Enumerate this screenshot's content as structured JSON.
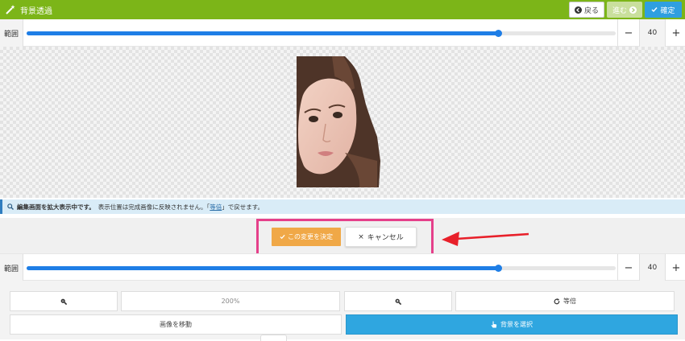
{
  "header": {
    "title": "背景透過",
    "back_label": "戻る",
    "next_label": "進む",
    "confirm_label": "確定"
  },
  "range_top": {
    "label": "範囲",
    "value": "40",
    "minus": "−",
    "plus": "+",
    "level": 0.8
  },
  "info": {
    "bold_text": "編集画面を拡大表示中です。",
    "text_before_link": "表示位置は完成画像に反映されません。「",
    "link_text": "等倍",
    "text_after_link": "」で戻せます。"
  },
  "decide": {
    "confirm_label": "この変更を決定",
    "cancel_label": "キャンセル"
  },
  "range_bottom": {
    "label": "範囲",
    "value": "40",
    "minus": "−",
    "plus": "+",
    "level": 0.8
  },
  "tools": {
    "zoom_level": "200%",
    "actual_size_label": "等倍",
    "move_label": "画像を移動",
    "select_label": "背景を選択"
  },
  "colors": {
    "header_bg": "#7cb518",
    "accent_blue": "#1e7ee6",
    "confirm_orange": "#f0a847",
    "highlight_pink": "#e5408a",
    "arrow_red": "#e8202a",
    "info_bg": "#d9ecf7"
  },
  "icons": [
    "magic-wand-icon",
    "arrow-left-circle-icon",
    "arrow-right-circle-icon",
    "check-icon",
    "times-icon",
    "zoom-out-icon",
    "zoom-in-icon",
    "refresh-icon",
    "hand-pointer-icon",
    "search-icon"
  ]
}
